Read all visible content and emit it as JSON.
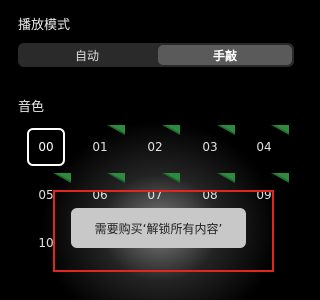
{
  "play_mode": {
    "title": "播放模式",
    "options": [
      "自动",
      "手敲"
    ],
    "selected": "手敲"
  },
  "tone": {
    "title": "音色",
    "items": [
      "00",
      "01",
      "02",
      "03",
      "04",
      "05",
      "06",
      "07",
      "08",
      "09",
      "10"
    ],
    "selected": "00"
  },
  "toast": {
    "message": "需要购买‘解锁所有内容’"
  },
  "colors": {
    "badge": "#1f6b2e",
    "highlight_box": "#e0261f",
    "toast_bg": "#c8c8c8"
  }
}
